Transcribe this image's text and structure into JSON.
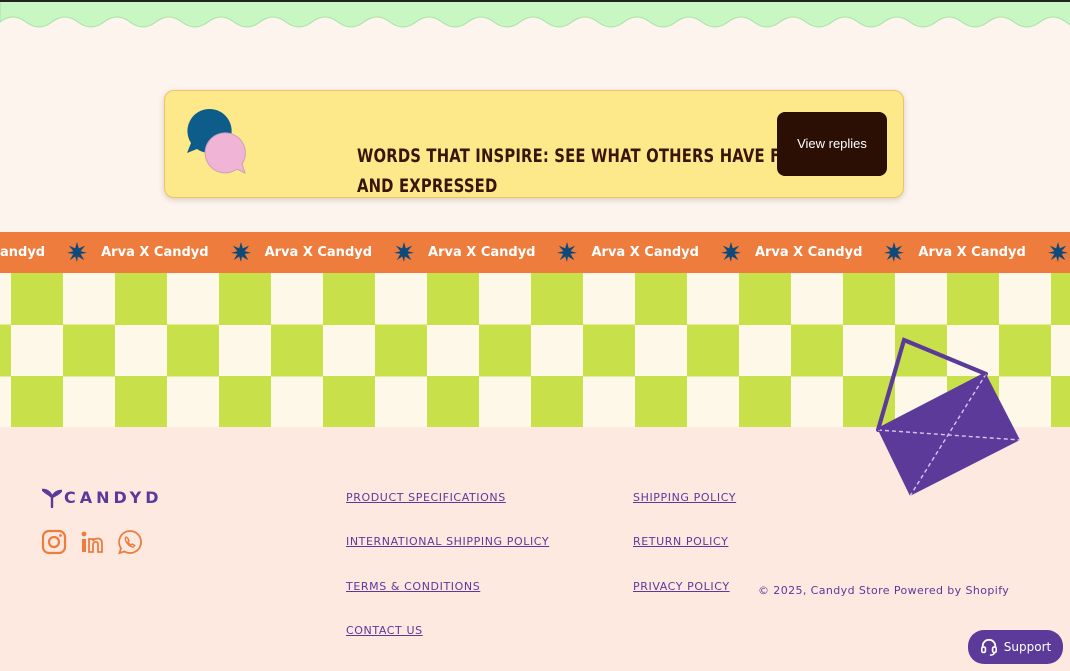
{
  "colors": {
    "background": "#fdf4ee",
    "wave_green": "#c9f7c3",
    "cta_yellow": "#fde98a",
    "cta_text": "#3b1408",
    "button_dark": "#2b0f05",
    "marquee_orange": "#ee7c3d",
    "checker_green": "#c8e04a",
    "checker_cream": "#fdf8e8",
    "brand_purple": "#5b3a9a",
    "footer_bg": "#fde9e0",
    "icon_orange": "#ee7c3d"
  },
  "cta": {
    "heading": "Words that inspire: see what others have felt and expressed",
    "button_label": "View replies",
    "icon": "speech-bubbles-icon"
  },
  "marquee": {
    "item_text": "Arva X Candyd",
    "leading_fragment": "andyd",
    "trailing_fragment": "Arva X",
    "icon": "star-burst-icon"
  },
  "footer": {
    "logo_text": "CANDYD",
    "social": [
      {
        "name": "instagram-icon"
      },
      {
        "name": "linkedin-icon"
      },
      {
        "name": "whatsapp-icon"
      }
    ],
    "links_col1": [
      "PRODUCT SPECIFICATIONS",
      "INTERNATIONAL SHIPPING POLICY",
      "TERMS & CONDITIONS",
      "CONTACT US"
    ],
    "links_col2": [
      "SHIPPING POLICY",
      "RETURN POLICY",
      "PRIVACY POLICY"
    ],
    "copyright": "© 2025, Candyd Store Powered by Shopify"
  },
  "support": {
    "label": "Support",
    "icon": "headset-icon"
  }
}
